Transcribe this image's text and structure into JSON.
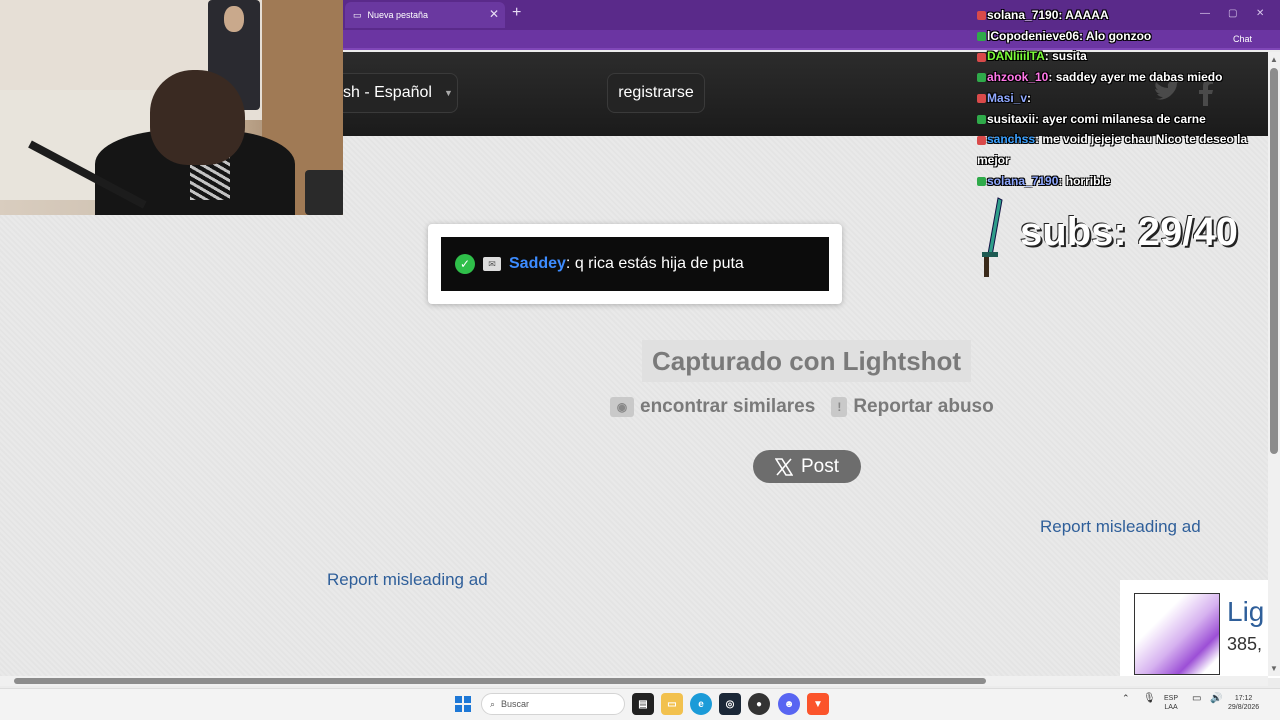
{
  "browser": {
    "tab_title": "Nueva pestaña",
    "tab_close": "✕",
    "new_tab": "+",
    "chat_button": "Chat"
  },
  "site_header": {
    "language_label": "sh - Español",
    "register_label": "registrarse"
  },
  "screenshot": {
    "username": "Saddey",
    "message": ": q rica estás hija de puta"
  },
  "main": {
    "captured_label": "Capturado con Lightshot",
    "find_similar_label": "encontrar similares",
    "report_abuse_label": "Reportar abuso",
    "post_label": "Post",
    "report_ad_1": "Report misleading ad",
    "report_ad_2": "Report misleading ad",
    "ad_title": "Lig",
    "ad_subtitle": "385,"
  },
  "stream_overlay": {
    "subs_text": "subs: 29/40",
    "chat": [
      {
        "user": "solana_7190",
        "user_color": "#ffffff",
        "message": "AAAAA"
      },
      {
        "user": "lCopodenieve06",
        "user_color": "#ffffff",
        "message": "Alo gonzoo"
      },
      {
        "user": "DANIiiiITA",
        "user_color": "#7cff3a",
        "message": "susita"
      },
      {
        "user": "ahzook_10",
        "user_color": "#ff77e8",
        "message": "saddey ayer me dabas miedo"
      },
      {
        "user": "Masi_v",
        "user_color": "#8fa8ff",
        "message": ""
      },
      {
        "user": "susitaxii",
        "user_color": "#ffffff",
        "message": "ayer comi milanesa de carne"
      },
      {
        "user": "sanchss",
        "user_color": "#3aa0ff",
        "message": "me void jejeje chau Nico te deseo la mejor"
      },
      {
        "user": "solana_7190",
        "user_color": "#8fa8ff",
        "message": "horrible"
      }
    ]
  },
  "taskbar": {
    "search_placeholder": "Buscar",
    "lang_line1": "ESP",
    "lang_line2": "LAA",
    "time": "17:12",
    "date": "29/8/2026"
  },
  "colors": {
    "browser_purple": "#5a2a8a",
    "link_blue": "#2f5f9a",
    "verified_green": "#2fbf4a"
  }
}
